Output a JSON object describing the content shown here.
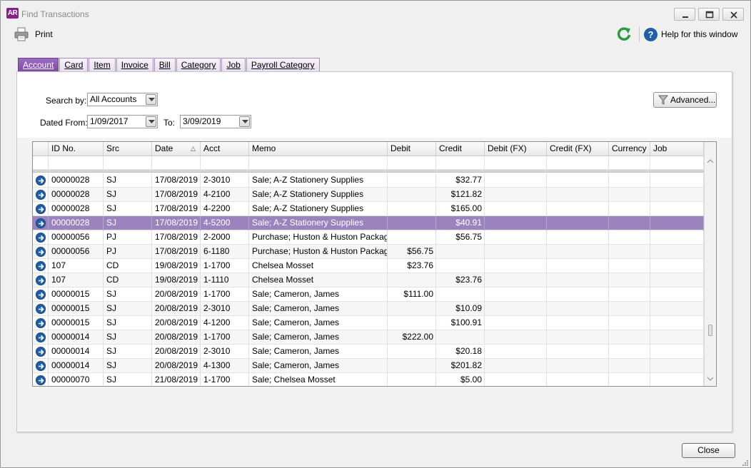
{
  "window": {
    "app_icon_text": "AR",
    "title": "Find Transactions"
  },
  "toolbar": {
    "print_label": "Print",
    "help_label": "Help for this window"
  },
  "tabs": [
    {
      "label": "Account",
      "active": true
    },
    {
      "label": "Card",
      "active": false
    },
    {
      "label": "Item",
      "active": false
    },
    {
      "label": "Invoice",
      "active": false
    },
    {
      "label": "Bill",
      "active": false
    },
    {
      "label": "Category",
      "active": false
    },
    {
      "label": "Job",
      "active": false
    },
    {
      "label": "Payroll Category",
      "active": false
    }
  ],
  "filters": {
    "search_by_label": "Search by:",
    "search_by_value": "All Accounts",
    "dated_from_label": "Dated From:",
    "dated_from_value": "1/09/2017",
    "to_label": "To:",
    "to_value": "3/09/2019",
    "advanced_label": "Advanced..."
  },
  "grid": {
    "columns": [
      "",
      "ID No.",
      "Src",
      "Date",
      "Acct",
      "Memo",
      "Debit",
      "Credit",
      "Debit (FX)",
      "Credit (FX)",
      "Currency",
      "Job"
    ],
    "sort_column": "Date",
    "sort_indicator": "△",
    "selected_row": 3,
    "rows": [
      {
        "id": "00000028",
        "src": "SJ",
        "date": "17/08/2019",
        "acct": "2-3010",
        "memo": "Sale; A-Z Stationery Supplies",
        "debit": "",
        "credit": "$32.77",
        "debit_fx": "",
        "credit_fx": "",
        "currency": "",
        "job": ""
      },
      {
        "id": "00000028",
        "src": "SJ",
        "date": "17/08/2019",
        "acct": "4-2100",
        "memo": "Sale; A-Z Stationery Supplies",
        "debit": "",
        "credit": "$121.82",
        "debit_fx": "",
        "credit_fx": "",
        "currency": "",
        "job": ""
      },
      {
        "id": "00000028",
        "src": "SJ",
        "date": "17/08/2019",
        "acct": "4-2200",
        "memo": "Sale; A-Z Stationery Supplies",
        "debit": "",
        "credit": "$165.00",
        "debit_fx": "",
        "credit_fx": "",
        "currency": "",
        "job": ""
      },
      {
        "id": "00000028",
        "src": "SJ",
        "date": "17/08/2019",
        "acct": "4-5200",
        "memo": "Sale; A-Z Stationery Supplies",
        "debit": "",
        "credit": "$40.91",
        "debit_fx": "",
        "credit_fx": "",
        "currency": "",
        "job": ""
      },
      {
        "id": "00000056",
        "src": "PJ",
        "date": "17/08/2019",
        "acct": "2-2000",
        "memo": "Purchase; Huston & Huston Packaging",
        "debit": "",
        "credit": "$56.75",
        "debit_fx": "",
        "credit_fx": "",
        "currency": "",
        "job": ""
      },
      {
        "id": "00000056",
        "src": "PJ",
        "date": "17/08/2019",
        "acct": "6-1180",
        "memo": "Purchase; Huston & Huston Packaging",
        "debit": "$56.75",
        "credit": "",
        "debit_fx": "",
        "credit_fx": "",
        "currency": "",
        "job": ""
      },
      {
        "id": "107",
        "src": "CD",
        "date": "19/08/2019",
        "acct": "1-1700",
        "memo": "Chelsea Mosset",
        "debit": "$23.76",
        "credit": "",
        "debit_fx": "",
        "credit_fx": "",
        "currency": "",
        "job": ""
      },
      {
        "id": "107",
        "src": "CD",
        "date": "19/08/2019",
        "acct": "1-1110",
        "memo": "Chelsea Mosset",
        "debit": "",
        "credit": "$23.76",
        "debit_fx": "",
        "credit_fx": "",
        "currency": "",
        "job": ""
      },
      {
        "id": "00000015",
        "src": "SJ",
        "date": "20/08/2019",
        "acct": "1-1700",
        "memo": "Sale; Cameron, James",
        "debit": "$111.00",
        "credit": "",
        "debit_fx": "",
        "credit_fx": "",
        "currency": "",
        "job": ""
      },
      {
        "id": "00000015",
        "src": "SJ",
        "date": "20/08/2019",
        "acct": "2-3010",
        "memo": "Sale; Cameron, James",
        "debit": "",
        "credit": "$10.09",
        "debit_fx": "",
        "credit_fx": "",
        "currency": "",
        "job": ""
      },
      {
        "id": "00000015",
        "src": "SJ",
        "date": "20/08/2019",
        "acct": "4-1200",
        "memo": "Sale; Cameron, James",
        "debit": "",
        "credit": "$100.91",
        "debit_fx": "",
        "credit_fx": "",
        "currency": "",
        "job": ""
      },
      {
        "id": "00000014",
        "src": "SJ",
        "date": "20/08/2019",
        "acct": "1-1700",
        "memo": "Sale; Cameron, James",
        "debit": "$222.00",
        "credit": "",
        "debit_fx": "",
        "credit_fx": "",
        "currency": "",
        "job": ""
      },
      {
        "id": "00000014",
        "src": "SJ",
        "date": "20/08/2019",
        "acct": "2-3010",
        "memo": "Sale; Cameron, James",
        "debit": "",
        "credit": "$20.18",
        "debit_fx": "",
        "credit_fx": "",
        "currency": "",
        "job": ""
      },
      {
        "id": "00000014",
        "src": "SJ",
        "date": "20/08/2019",
        "acct": "4-1300",
        "memo": "Sale; Cameron, James",
        "debit": "",
        "credit": "$201.82",
        "debit_fx": "",
        "credit_fx": "",
        "currency": "",
        "job": ""
      },
      {
        "id": "00000070",
        "src": "SJ",
        "date": "21/08/2019",
        "acct": "1-1700",
        "memo": "Sale; Chelsea Mosset",
        "debit": "",
        "credit": "$5.00",
        "debit_fx": "",
        "credit_fx": "",
        "currency": "",
        "job": ""
      }
    ]
  },
  "footer": {
    "close_label": "Close"
  },
  "colors": {
    "accent_tab": "#7d4aa6",
    "selected_row": "#9b84be",
    "arrow_icon": "#1f5fa8",
    "refresh_icon": "#2e9b3a"
  },
  "icons": {
    "app": "ar-logo-icon",
    "print": "printer-icon",
    "refresh": "refresh-icon",
    "help": "help-icon",
    "row_zoom": "zoom-arrow-icon",
    "advanced": "funnel-icon"
  }
}
